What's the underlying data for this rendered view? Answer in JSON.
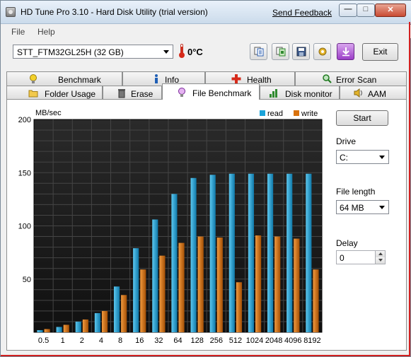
{
  "window": {
    "title": "HD Tune Pro 3.10 - Hard Disk Utility (trial version)",
    "send_feedback": "Send Feedback",
    "min_glyph": "—",
    "max_glyph": "□",
    "close_glyph": "✕"
  },
  "menu": {
    "file": "File",
    "help": "Help"
  },
  "toolbar": {
    "drive": "STT_FTM32GL25H (32 GB)",
    "temperature": "0°C",
    "exit_label": "Exit",
    "buttons": [
      "copy-text-icon",
      "copy-screenshot-icon",
      "save-icon",
      "options-icon",
      "download-icon"
    ]
  },
  "tabs": {
    "row1": [
      "Benchmark",
      "Info",
      "Health",
      "Error Scan"
    ],
    "row2": [
      "Folder Usage",
      "Erase",
      "File Benchmark",
      "Disk monitor",
      "AAM"
    ],
    "active": "File Benchmark"
  },
  "controls": {
    "start_label": "Start",
    "drive_label": "Drive",
    "drive_value": "C:",
    "file_length_label": "File length",
    "file_length_value": "64 MB",
    "delay_label": "Delay",
    "delay_value": "0"
  },
  "colors": {
    "read": "#1aa3d9",
    "write": "#d9720e",
    "plot_bg": "#1e1e1e"
  },
  "chart_data": {
    "type": "bar",
    "ylabel": "MB/sec",
    "ylim": [
      0,
      200
    ],
    "yticks": [
      50,
      100,
      150,
      200
    ],
    "categories": [
      "0.5",
      "1",
      "2",
      "4",
      "8",
      "16",
      "32",
      "64",
      "128",
      "256",
      "512",
      "1024",
      "2048",
      "4096",
      "8192"
    ],
    "series": [
      {
        "name": "read",
        "values": [
          2,
          5,
          10,
          18,
          43,
          79,
          106,
          130,
          145,
          148,
          149,
          149,
          149,
          149,
          149
        ]
      },
      {
        "name": "write",
        "values": [
          3,
          7,
          12,
          20,
          35,
          59,
          72,
          84,
          90,
          89,
          47,
          91,
          90,
          88,
          59
        ]
      }
    ],
    "legend": "top-right",
    "grid": true
  }
}
